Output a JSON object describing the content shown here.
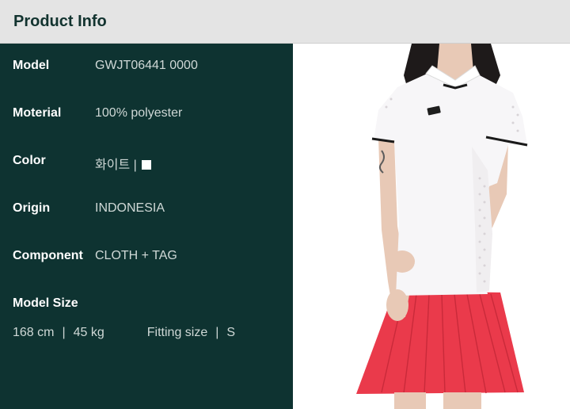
{
  "header": {
    "title": "Product Info"
  },
  "specs": [
    {
      "label": "Model",
      "value": "GWJT06441 0000"
    },
    {
      "label": "Moterial",
      "value": "100% polyester"
    },
    {
      "label": "Color",
      "value": "화이트 |"
    },
    {
      "label": "Origin",
      "value": "INDONESIA"
    },
    {
      "label": "Component",
      "value": "CLOTH + TAG"
    }
  ],
  "model_size": {
    "label": "Model Size",
    "height": "168 cm",
    "weight": "45 kg",
    "fitting_label": "Fitting size",
    "fitting_value": "S",
    "separator": "|"
  },
  "color_swatch": "#ffffff",
  "photo": {
    "shirt_color": "#f7f6f8",
    "skirt_color": "#ea3a4b",
    "trim_color": "#1a1a1a"
  }
}
